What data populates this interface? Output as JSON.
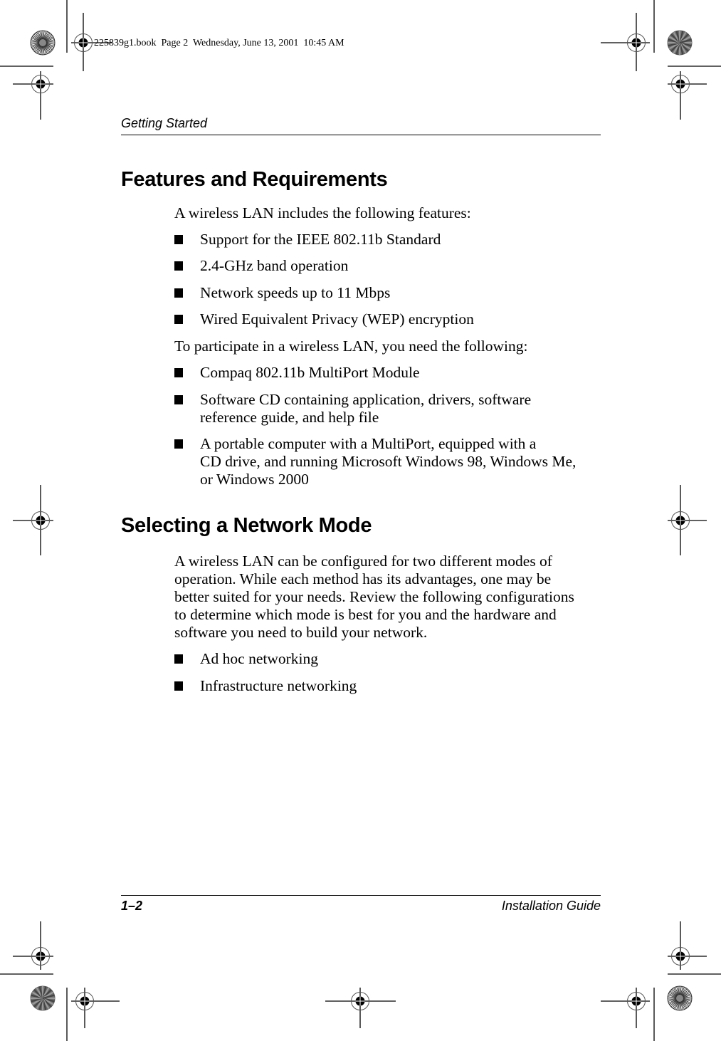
{
  "slug": "225839g1.book  Page 2  Wednesday, June 13, 2001  10:45 AM",
  "header": {
    "running_head": "Getting Started"
  },
  "sections": [
    {
      "heading": "Features and Requirements",
      "intro": "A wireless LAN includes the following features:",
      "bullets": [
        "Support for the IEEE 802.11b Standard",
        "2.4-GHz band operation",
        "Network speeds up to 11 Mbps",
        "Wired Equivalent Privacy (WEP) encryption"
      ],
      "intro2": "To participate in a wireless LAN, you need the following:",
      "bullets2": [
        [
          "Compaq 802.11b MultiPort Module"
        ],
        [
          "Software CD containing application, drivers, software",
          "reference guide, and help file"
        ],
        [
          "A portable computer with a MultiPort, equipped with a",
          "CD drive, and running Microsoft Windows 98, Windows Me,",
          "or Windows 2000"
        ]
      ]
    },
    {
      "heading": "Selecting a Network Mode",
      "paragraph": [
        "A wireless LAN can be configured for two different modes of",
        "operation. While each method has its advantages, one may be",
        "better suited for your needs. Review the following configurations",
        "to determine which mode is best for you and the hardware and",
        "software you need to build your network."
      ],
      "bullets": [
        "Ad hoc networking",
        "Infrastructure networking"
      ]
    }
  ],
  "footer": {
    "page_number": "1–2",
    "book_title": "Installation Guide"
  },
  "marks": {
    "registration_mark_icon": "registration-target",
    "color_wheel_icon": "starburst-wheel"
  }
}
